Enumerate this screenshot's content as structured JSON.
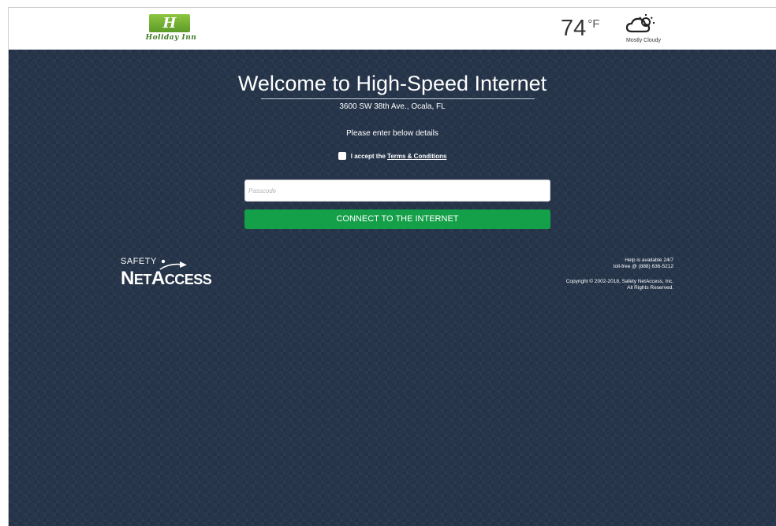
{
  "header": {
    "logo": {
      "badge_text": "H",
      "script_text": "Holiday Inn"
    },
    "weather": {
      "temperature": "74",
      "unit": "°F",
      "condition": "Mostly Cloudy",
      "icon": "partly-cloudy-icon"
    }
  },
  "main": {
    "title": "Welcome to High-Speed Internet",
    "address": "3600 SW 38th Ave., Ocala, FL",
    "instructions": "Please enter below details",
    "terms": {
      "prefix": "I accept the",
      "link_text": "Terms & Conditions",
      "checked": false
    },
    "passcode": {
      "placeholder": "Passcode",
      "value": ""
    },
    "connect_button": "CONNECT TO THE INTERNET"
  },
  "footer": {
    "brand": {
      "top": "SAFETY",
      "main_cap1": "N",
      "main_rest1": "ET",
      "main_cap2": "A",
      "main_rest2": "CCESS"
    },
    "help_line1": "Help is available 24/7",
    "help_line2": "toll-free @ (888) 636-5212",
    "copyright_line1": "Copyright © 2002-2018, Safety NetAccess, Inc.",
    "copyright_line2": "All Rights Reserved."
  },
  "colors": {
    "background": "#26354a",
    "button": "#13a048",
    "logo_green": "#6aa84f"
  }
}
